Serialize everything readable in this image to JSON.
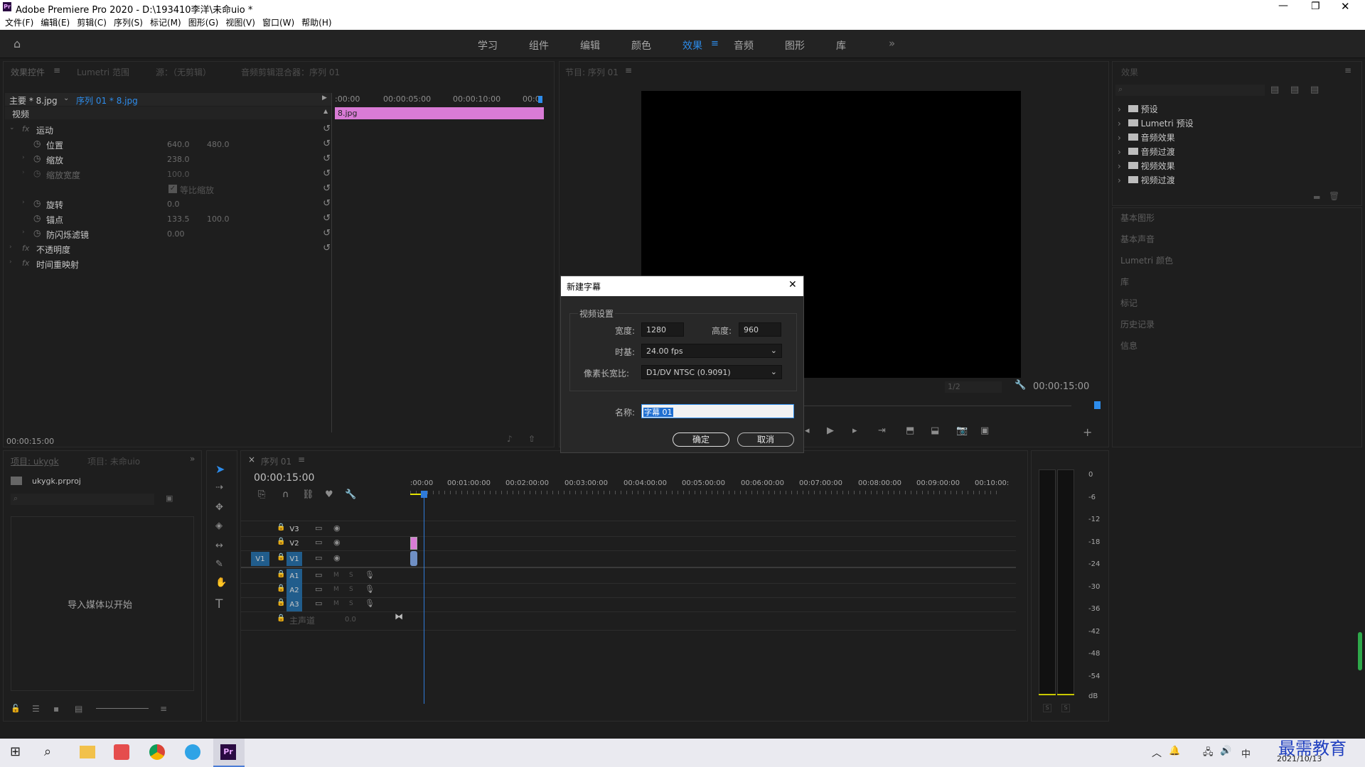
{
  "app": {
    "title": "Adobe Premiere Pro 2020 - D:\\193410李洋\\未命uio *",
    "icon": "Pr"
  },
  "menu": [
    "文件(F)",
    "编辑(E)",
    "剪辑(C)",
    "序列(S)",
    "标记(M)",
    "图形(G)",
    "视图(V)",
    "窗口(W)",
    "帮助(H)"
  ],
  "workspaces": [
    "学习",
    "组件",
    "编辑",
    "颜色",
    "效果",
    "音频",
    "图形",
    "库"
  ],
  "active_workspace": "效果",
  "effect_controls": {
    "tabs": [
      "效果控件",
      "Lumetri 范围",
      "源：（无剪辑）",
      "音频剪辑混合器：序列 01"
    ],
    "master": "主要 * 8.jpg",
    "sequence": "序列 01 * 8.jpg",
    "video_label": "视频",
    "motion": "运动",
    "properties": [
      {
        "name": "位置",
        "v1": "640.0",
        "v2": "480.0"
      },
      {
        "name": "缩放",
        "v1": "238.0",
        "v2": ""
      },
      {
        "name": "缩放宽度",
        "v1": "100.0",
        "v2": ""
      },
      {
        "name": "旋转",
        "v1": "0.0",
        "v2": ""
      },
      {
        "name": "锚点",
        "v1": "133.5",
        "v2": "100.0"
      },
      {
        "name": "防闪烁滤镜",
        "v1": "0.00",
        "v2": ""
      }
    ],
    "uniform_scale": "等比缩放",
    "opacity": "不透明度",
    "time_remap": "时间重映射",
    "ruler": [
      ":00:00",
      "00:00:05:00",
      "00:00:10:00",
      "00:0"
    ],
    "clip": "8.jpg",
    "timecode": "00:00:15:00"
  },
  "program": {
    "tab": "节目: 序列 01",
    "timecode": "00:00:15:00",
    "zoom": "1/2"
  },
  "dialog": {
    "title": "新建字幕",
    "group": "视频设置",
    "width_label": "宽度:",
    "width": "1280",
    "height_label": "高度:",
    "height": "960",
    "timebase_label": "时基:",
    "timebase": "24.00 fps",
    "par_label": "像素长宽比:",
    "par": "D1/DV NTSC (0.9091)",
    "name_label": "名称:",
    "name": "字幕 01",
    "ok": "确定",
    "cancel": "取消"
  },
  "project": {
    "tabs": [
      "项目: ukygk",
      "项目: 未命uio"
    ],
    "file": "ukygk.prproj",
    "hint": "导入媒体以开始"
  },
  "timeline": {
    "tab": "序列 01",
    "timecode": "00:00:15:00",
    "ruler": [
      ":00:00",
      "00:01:00:00",
      "00:02:00:00",
      "00:03:00:00",
      "00:04:00:00",
      "00:05:00:00",
      "00:06:00:00",
      "00:07:00:00",
      "00:08:00:00",
      "00:09:00:00",
      "00:10:00:"
    ],
    "video_tracks": [
      "V3",
      "V2",
      "V1"
    ],
    "audio_tracks": [
      "A1",
      "A2",
      "A3"
    ],
    "source_v": "V1",
    "master": "主声道",
    "master_val": "0.0",
    "track_m": "M",
    "track_s": "S"
  },
  "effects": {
    "tab": "效果",
    "folders": [
      "预设",
      "Lumetri 预设",
      "音频效果",
      "音频过渡",
      "视频效果",
      "视频过渡"
    ],
    "panels": [
      "基本图形",
      "基本声音",
      "Lumetri 颜色",
      "库",
      "标记",
      "历史记录",
      "信息"
    ]
  },
  "meter": {
    "scale": [
      "0",
      "-6",
      "-12",
      "-18",
      "-24",
      "-30",
      "-36",
      "-42",
      "-48",
      "-54",
      "dB"
    ],
    "s": "S"
  },
  "taskbar": {
    "date": "2021/10/13",
    "ime": "中",
    "watermark": "最需教育"
  },
  "colors": {
    "accent": "#2d8ceb",
    "clip_pink": "#d97bd6",
    "playhead": "#2f7bd9",
    "track_blue": "#215d8c"
  }
}
